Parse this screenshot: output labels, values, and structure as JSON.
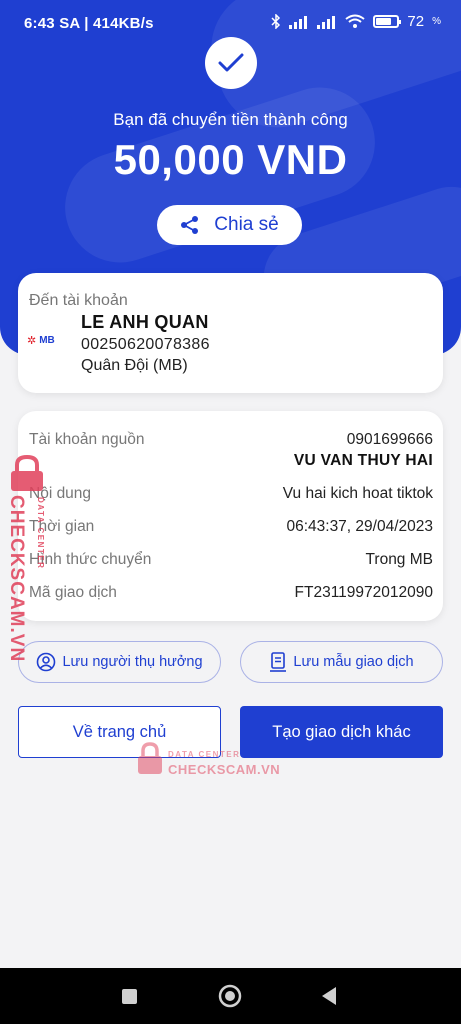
{
  "status_bar": {
    "time": "6:43 SA",
    "speed": "414KB/s",
    "battery_percent": "72",
    "battery_level": 0.72
  },
  "hero": {
    "subtitle": "Bạn đã chuyển tiền thành công",
    "amount": "50,000 VND",
    "share_label": "Chia sẻ"
  },
  "recipient": {
    "label": "Đến tài khoản",
    "bank_logo_text": "MB",
    "name": "LE ANH QUAN",
    "account_number": "00250620078386",
    "bank_name": "Quân Đội (MB)"
  },
  "details": {
    "source_label": "Tài khoản nguồn",
    "source_account": "0901699666",
    "source_name": "VU VAN THUY HAI",
    "content_label": "Nội dung",
    "content_value": "Vu hai kich hoat tiktok",
    "time_label": "Thời gian",
    "time_value": "06:43:37, 29/04/2023",
    "method_label": "Hình thức chuyển",
    "method_value": "Trong MB",
    "code_label": "Mã giao dịch",
    "code_value": "FT23119972012090"
  },
  "actions": {
    "save_beneficiary": "Lưu người thụ hưởng",
    "save_template": "Lưu mẫu giao dịch",
    "home": "Về trang chủ",
    "new_transaction": "Tạo giao dịch khác"
  },
  "watermark": {
    "brand": "CHECKSCAM.VN",
    "sub": "DATA CENTER"
  },
  "colors": {
    "primary": "#1f3fd1",
    "background": "#f3f3f5",
    "watermark": "#e0405a"
  }
}
